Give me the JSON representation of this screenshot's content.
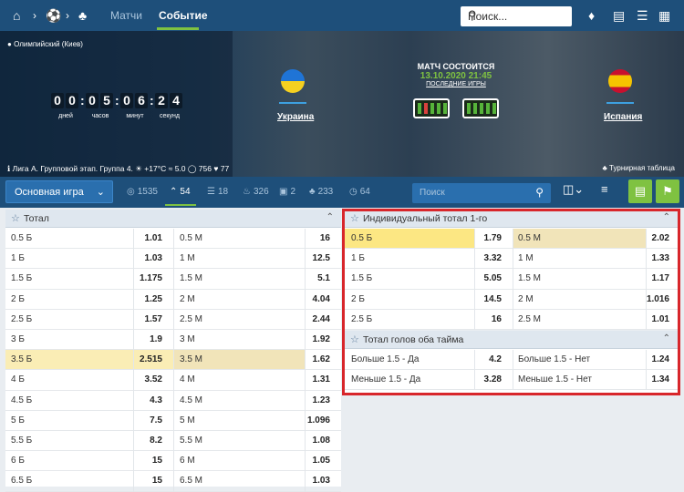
{
  "topbar": {
    "tabs": [
      "Матчи",
      "Событие"
    ],
    "search_placeholder": "Поиск..."
  },
  "hero": {
    "stadium": "Олимпийский (Киев)",
    "timer": {
      "digits": [
        "0",
        "0",
        "0",
        "5",
        "0",
        "6",
        "2",
        "4"
      ],
      "labels": [
        "дней",
        "часов",
        "минут",
        "секунд"
      ]
    },
    "home_team": "Украина",
    "away_team": "Испания",
    "match_title": "МАТЧ СОСТОИТСЯ",
    "match_date": "13.10.2020 21:45",
    "last_games": "ПОСЛЕДНИЕ ИГРЫ",
    "league": "Лига А. Групповой этап. Группа 4.",
    "weather": "+17°C",
    "wind": "5.0",
    "viewers": "756",
    "likes": "77",
    "tournament_table": "Турнирная таблица"
  },
  "navbar": {
    "dropdown": "Основная игра",
    "tabs": [
      {
        "icon": "target-icon",
        "count": "1535"
      },
      {
        "icon": "chevron-icon",
        "count": "54"
      },
      {
        "icon": "list-icon",
        "count": "18"
      },
      {
        "icon": "fire-icon",
        "count": "326"
      },
      {
        "icon": "shirt-icon",
        "count": "2"
      },
      {
        "icon": "cup-icon",
        "count": "233"
      },
      {
        "icon": "clock-icon",
        "count": "64"
      }
    ],
    "search_placeholder": "Поиск"
  },
  "total": {
    "title": "Тотал",
    "rows": [
      {
        "over": "0.5 Б",
        "over_odd": "1.01",
        "under": "0.5 М",
        "under_odd": "16"
      },
      {
        "over": "1 Б",
        "over_odd": "1.03",
        "under": "1 М",
        "under_odd": "12.5"
      },
      {
        "over": "1.5 Б",
        "over_odd": "1.175",
        "under": "1.5 М",
        "under_odd": "5.1"
      },
      {
        "over": "2 Б",
        "over_odd": "1.25",
        "under": "2 М",
        "under_odd": "4.04"
      },
      {
        "over": "2.5 Б",
        "over_odd": "1.57",
        "under": "2.5 М",
        "under_odd": "2.44"
      },
      {
        "over": "3 Б",
        "over_odd": "1.9",
        "under": "3 М",
        "under_odd": "1.92"
      },
      {
        "over": "3.5 Б",
        "over_odd": "2.515",
        "under": "3.5 М",
        "under_odd": "1.62"
      },
      {
        "over": "4 Б",
        "over_odd": "3.52",
        "under": "4 М",
        "under_odd": "1.31"
      },
      {
        "over": "4.5 Б",
        "over_odd": "4.3",
        "under": "4.5 М",
        "under_odd": "1.23"
      },
      {
        "over": "5 Б",
        "over_odd": "7.5",
        "under": "5 М",
        "under_odd": "1.096"
      },
      {
        "over": "5.5 Б",
        "over_odd": "8.2",
        "under": "5.5 М",
        "under_odd": "1.08"
      },
      {
        "over": "6 Б",
        "over_odd": "15",
        "under": "6 М",
        "under_odd": "1.05"
      },
      {
        "over": "6.5 Б",
        "over_odd": "15",
        "under": "6.5 М",
        "under_odd": "1.03"
      }
    ]
  },
  "individual_total": {
    "title": "Индивидуальный тотал 1-го",
    "rows": [
      {
        "over": "0.5 Б",
        "over_odd": "1.79",
        "under": "0.5 М",
        "under_odd": "2.02"
      },
      {
        "over": "1 Б",
        "over_odd": "3.32",
        "under": "1 М",
        "under_odd": "1.33"
      },
      {
        "over": "1.5 Б",
        "over_odd": "5.05",
        "under": "1.5 М",
        "under_odd": "1.17"
      },
      {
        "over": "2 Б",
        "over_odd": "14.5",
        "under": "2 М",
        "under_odd": "1.016"
      },
      {
        "over": "2.5 Б",
        "over_odd": "16",
        "under": "2.5 М",
        "under_odd": "1.01"
      }
    ]
  },
  "both_halves": {
    "title": "Тотал голов оба тайма",
    "rows": [
      {
        "over": "Больше 1.5 - Да",
        "over_odd": "4.2",
        "under": "Больше 1.5 - Нет",
        "under_odd": "1.24"
      },
      {
        "over": "Меньше 1.5 - Да",
        "over_odd": "3.28",
        "under": "Меньше 1.5 - Нет",
        "under_odd": "1.34"
      }
    ]
  }
}
